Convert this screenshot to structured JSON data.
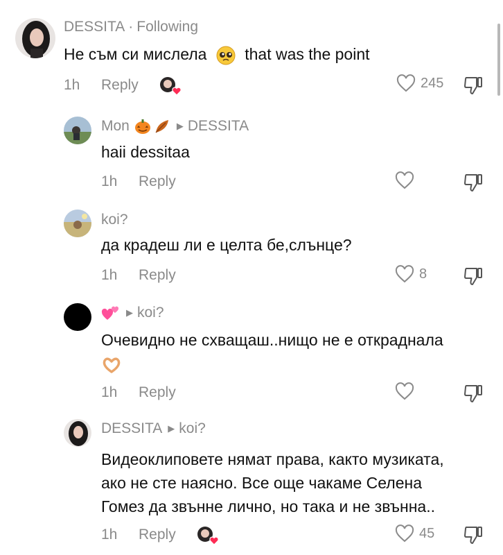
{
  "colors": {
    "text": "#111111",
    "muted": "#8a8a8a",
    "heart_badge": "#fe2c55",
    "background": "#ffffff"
  },
  "comments": [
    {
      "author": "DESSITA",
      "separator": "·",
      "following_label": "Following",
      "text_before_emoji": "Не съм си мислела",
      "emoji": "pleading-face",
      "text_after_emoji": "that was the point",
      "time": "1h",
      "reply_label": "Reply",
      "liked_by_creator": true,
      "likes": "245"
    },
    {
      "author": "Mon",
      "author_emojis": [
        "jack-o-lantern",
        "fallen-leaf"
      ],
      "reply_to": "DESSITA",
      "text": "haii dessitaa",
      "time": "1h",
      "reply_label": "Reply",
      "likes": ""
    },
    {
      "author": "koi?",
      "text": "да крадеш ли е целта бе,слънце?",
      "time": "1h",
      "reply_label": "Reply",
      "likes": "8"
    },
    {
      "author_emoji": "two-hearts",
      "reply_to": "koi?",
      "text": "Очевидно не схващаш..нищо не е откраднала",
      "text_emoji": "heart-hands",
      "time": "1h",
      "reply_label": "Reply",
      "likes": ""
    },
    {
      "author": "DESSITA",
      "reply_to": "koi?",
      "text_lines": [
        "Видеоклиповете нямат права, както музиката,",
        "ако не сте наясно. Все още чакаме Селена",
        "Гомез да звънне лично, но така и не звънна.."
      ],
      "time": "1h",
      "reply_label": "Reply",
      "liked_by_creator": true,
      "likes": "45"
    }
  ]
}
